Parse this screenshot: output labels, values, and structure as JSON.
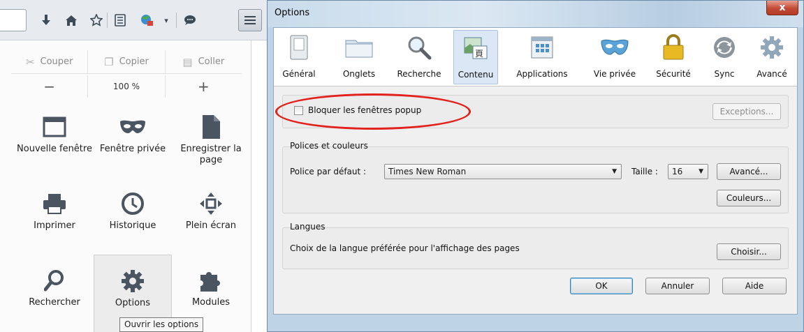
{
  "menu": {
    "edit": {
      "cut": "Couper",
      "copy": "Copier",
      "paste": "Coller"
    },
    "zoom": {
      "minus": "−",
      "level": "100 %",
      "plus": "+"
    },
    "items": [
      {
        "label": "Nouvelle fenêtre",
        "icon": "window-icon"
      },
      {
        "label": "Fenêtre privée",
        "icon": "mask-icon"
      },
      {
        "label": "Enregistrer la page",
        "icon": "page-icon"
      },
      {
        "label": "Imprimer",
        "icon": "printer-icon"
      },
      {
        "label": "Historique",
        "icon": "clock-icon"
      },
      {
        "label": "Plein écran",
        "icon": "fullscreen-icon"
      },
      {
        "label": "Rechercher",
        "icon": "search-icon"
      },
      {
        "label": "Options",
        "icon": "gear-icon"
      },
      {
        "label": "Modules",
        "icon": "puzzle-icon"
      }
    ],
    "tooltip": "Ouvrir les options"
  },
  "dialog": {
    "title": "Options",
    "close": "x",
    "categories": [
      "Général",
      "Onglets",
      "Recherche",
      "Contenu",
      "Applications",
      "Vie privée",
      "Sécurité",
      "Sync",
      "Avancé"
    ],
    "selected_category": "Contenu",
    "popup": {
      "label": "Bloquer les fenêtres popup",
      "checked": false,
      "exceptions": "Exceptions..."
    },
    "fonts": {
      "group_title": "Polices et couleurs",
      "default_font_label": "Police par défaut :",
      "default_font_value": "Times New Roman",
      "size_label": "Taille :",
      "size_value": "16",
      "advanced": "Avancé...",
      "colors": "Couleurs..."
    },
    "languages": {
      "group_title": "Langues",
      "description": "Choix de la langue préférée pour l'affichage des pages",
      "choose": "Choisir..."
    },
    "buttons": {
      "ok": "OK",
      "cancel": "Annuler",
      "help": "Aide"
    }
  },
  "colors": {
    "annotation": "#e2211c",
    "selected_tab": "#dbe7f5",
    "dialog_frame": "#bfd3e6"
  }
}
